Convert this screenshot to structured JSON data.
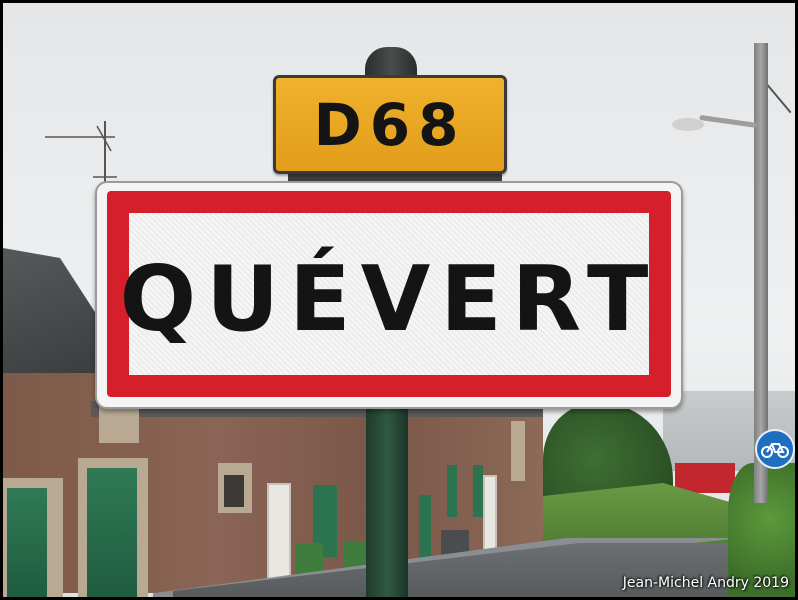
{
  "route_sign": {
    "text": "D68",
    "color": "#e9a823"
  },
  "town_sign": {
    "name": "QUÉVERT",
    "border_color": "#d51f2a"
  },
  "credit": "Jean-Michel Andry 2019",
  "icons": {
    "bicycle": "bicycle-icon"
  }
}
